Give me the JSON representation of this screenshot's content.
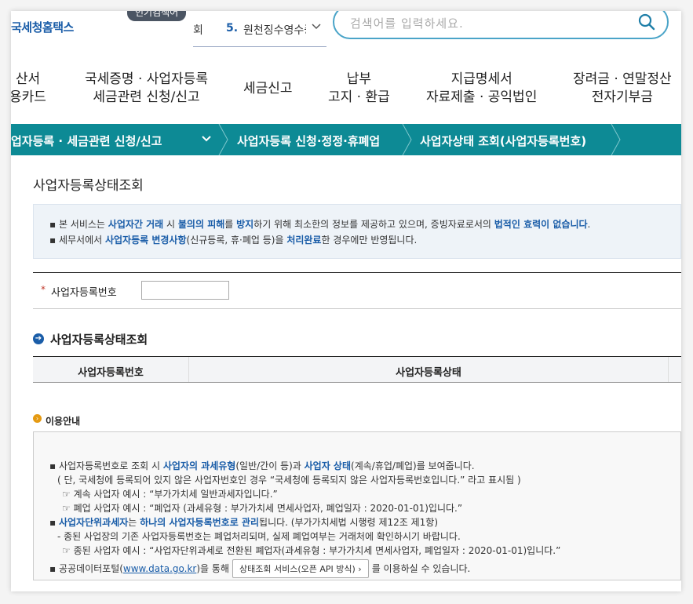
{
  "header": {
    "logo": "국세청홈택스",
    "hot_badge": "인기검색어",
    "hot_prev": "회",
    "hot_rank": "5.",
    "hot_term": "원천징수영수증",
    "search_placeholder": "검색어를 입력하세요."
  },
  "nav": [
    {
      "line1": "산서",
      "line2": "용카드"
    },
    {
      "line1": "국세증명 · 사업자등록",
      "line2": "세금관련 신청/신고"
    },
    {
      "line1": "세금신고",
      "line2": ""
    },
    {
      "line1": "납부",
      "line2": "고지 · 환급"
    },
    {
      "line1": "지급명세서",
      "line2": "자료제출 · 공익법인"
    },
    {
      "line1": "장려금 · 연말정산",
      "line2": "전자기부금"
    }
  ],
  "breadcrumb": [
    {
      "label": "업자등록 · 세금관련 신청/신고"
    },
    {
      "label": "사업자등록 신청·정정·휴폐업"
    },
    {
      "label": "사업자상태 조회(사업자등록번호)"
    }
  ],
  "main": {
    "title": "사업자등록상태조회",
    "notice1": {
      "a": "본 서비스는 ",
      "b": "사업자간 거래",
      "c": " 시 ",
      "d": "불의의 피해",
      "e": "를 ",
      "f": "방지",
      "g": "하기 위해 최소한의 정보를 제공하고 있으며, 증빙자료로서의 ",
      "h": "법적인 효력이 없습니다",
      "i": "."
    },
    "notice2": {
      "a": "세무서에서 ",
      "b": "사업자등록 변경사항",
      "c": "(신규등록, 휴·폐업 등)을 ",
      "d": "처리완료",
      "e": "한 경우에만 반영됩니다."
    },
    "form_required": "*",
    "form_label": "사업자등록번호",
    "form_value": "",
    "result_title": "사업자등록상태조회",
    "result_columns": [
      "사업자등록번호",
      "사업자등록상태"
    ]
  },
  "guide": {
    "title": "이용안내",
    "l1": {
      "a": "사업자등록번호로 조회 시 ",
      "b": "사업자의 과세유형",
      "c": "(일반/간이 등)과 ",
      "d": "사업자 상태",
      "e": "(계속/휴업/폐업)를 보여줍니다."
    },
    "l2": "( 단, 국세청에 등록되어 있지 않은 사업자번호인 경우 “국세청에 등록되지 않은 사업자등록번호입니다.” 라고 표시됨 )",
    "l3": "☞ 계속 사업자 예시 : “부가가치세 일반과세자입니다.”",
    "l4": "☞ 폐업 사업자 예시 : “폐업자 (과세유형 : 부가가치세 면세사업자, 폐업일자 : 2020-01-01)입니다.”",
    "l5": {
      "a": "사업자단위과세자",
      "b": "는 ",
      "c": "하나의 사업자등록번호로 관리",
      "d": "됩니다. (부가가치세법 시행령 제12조 제1항)"
    },
    "l6": "- 종된 사업장의 기존 사업자등록번호는 폐업처리되며, 실제 폐업여부는 거래처에 확인하시기 바랍니다.",
    "l7": "☞ 종된 사업자 예시 : “사업자단위과세로 전환된 폐업자(과세유형 : 부가가치세 면세사업자, 폐업일자 : 2020-01-01)입니다.”",
    "l8": {
      "a": "공공데이터포털(",
      "link": "www.data.go.kr",
      "b": ")을 통해",
      "button": "상태조회 서비스(오픈 API 방식)  ›",
      "c": "를 이용하실 수 있습니다."
    }
  },
  "colors": {
    "accent": "#1a5da8",
    "breadcrumb_bg": "#0d8a95",
    "search_border": "#4aa4c8"
  }
}
